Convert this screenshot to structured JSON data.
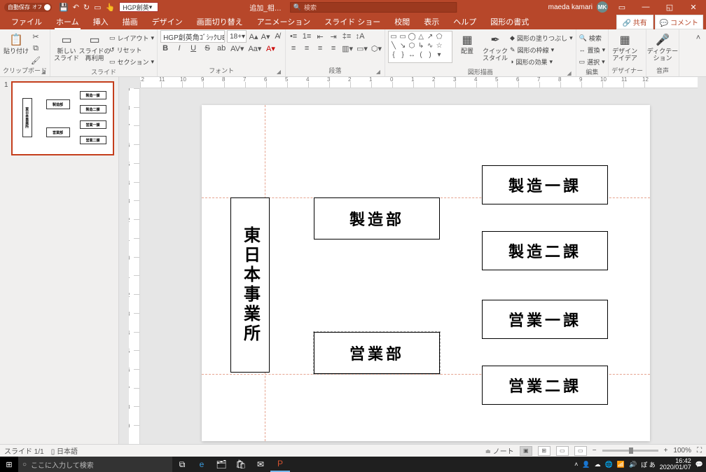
{
  "titlebar": {
    "autosave_label": "自動保存",
    "autosave_state": "オフ",
    "qat_font_selector": "HGP創英",
    "document_title": "追加_相…",
    "search_placeholder": "検索",
    "user_name": "maeda kamari",
    "user_initials": "MK"
  },
  "tabs": {
    "file": "ファイル",
    "home": "ホーム",
    "insert": "挿入",
    "draw": "描画",
    "design": "デザイン",
    "transitions": "画面切り替え",
    "animations": "アニメーション",
    "slideshow": "スライド ショー",
    "review": "校閲",
    "view": "表示",
    "help": "ヘルプ",
    "shape_format": "図形の書式",
    "share": "共有",
    "comments": "コメント"
  },
  "ribbon": {
    "clipboard": {
      "paste": "貼り付け",
      "label": "クリップボード"
    },
    "slides": {
      "new_slide": "新しい\nスライド",
      "reuse": "スライドの\n再利用",
      "layout": "レイアウト",
      "reset": "リセット",
      "section": "セクション",
      "label": "スライド"
    },
    "font": {
      "name": "HGP創英角ｺﾞｼｯｸUB 本",
      "size": "18+",
      "label": "フォント"
    },
    "paragraph": {
      "label": "段落"
    },
    "drawing": {
      "arrange": "配置",
      "quick_styles": "クイック\nスタイル",
      "fill": "図形の塗りつぶし",
      "outline": "図形の枠線",
      "effects": "図形の効果",
      "label": "図形描画"
    },
    "editing": {
      "find": "検索",
      "replace": "置換",
      "select": "選択",
      "label": "編集"
    },
    "designer": {
      "label_btn": "デザイン\nアイデア",
      "label": "デザイナー"
    },
    "voice": {
      "dictate": "ディクテー\nション",
      "label": "音声"
    }
  },
  "thumbnails": {
    "slide1_num": "1"
  },
  "slide": {
    "box_main": "東日本事業所",
    "box_mfg": "製造部",
    "box_sales": "営業部",
    "box_mfg1": "製造一課",
    "box_mfg2": "製造二課",
    "box_sales1": "営業一課",
    "box_sales2": "営業二課"
  },
  "status": {
    "slide_counter": "スライド 1/1",
    "language": "日本語",
    "notes": "ノート",
    "zoom": "100%"
  },
  "taskbar": {
    "search_placeholder": "ここに入力して検索",
    "ime_symbols": "ぽ あ",
    "time": "16:42",
    "date": "2020/01/07"
  }
}
